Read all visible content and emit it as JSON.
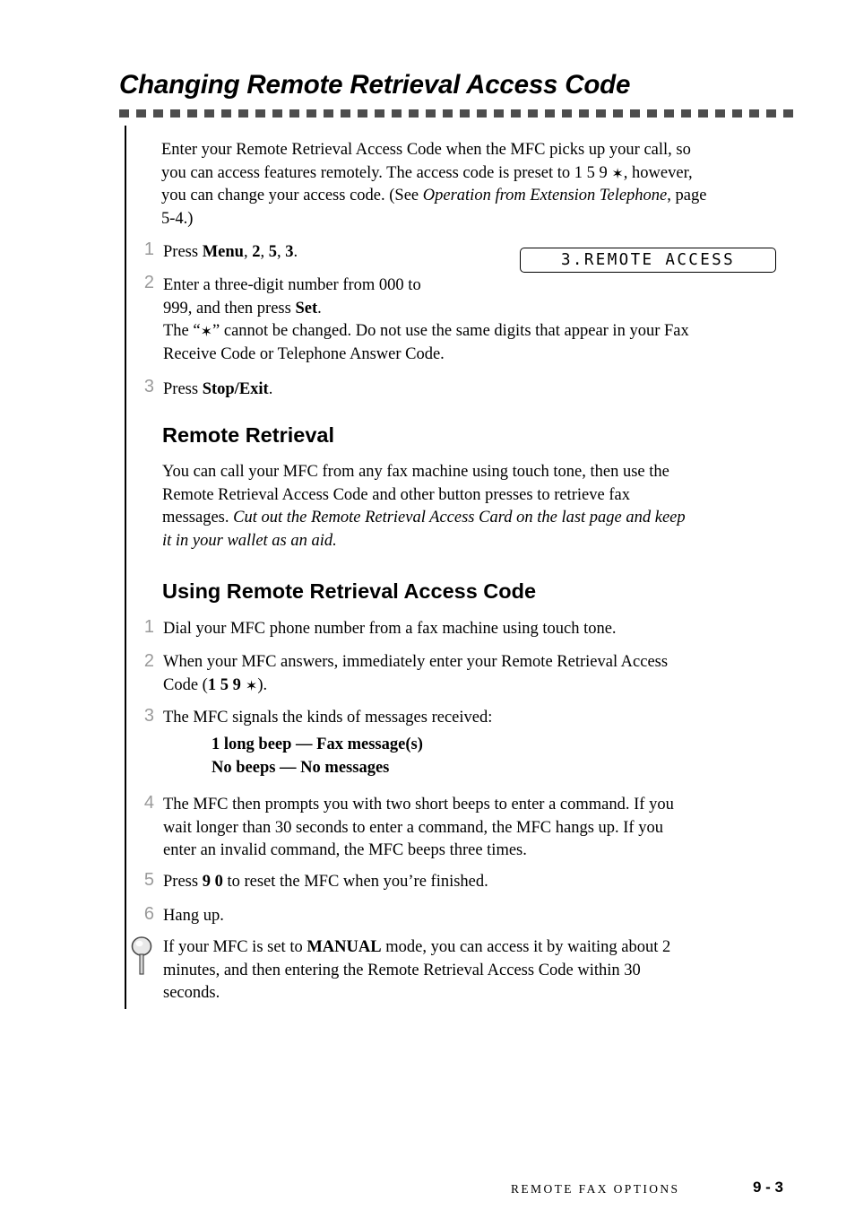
{
  "document": {
    "title": "Changing Remote Retrieval Access Code",
    "intro": "Enter your Remote Retrieval Access Code when the MFC picks up your call, so you can access features remotely.  The access code is preset to 1 5 9 ✶, however, you can change your access code. (See Operation from Extension Telephone, page 5-4.)",
    "intro_line1": "Enter your Remote Retrieval Access Code when the MFC picks up your call, so",
    "intro_line2a": "you can access features remotely.  The access code is preset to 1 5 9 ",
    "intro_line2b": ", however,",
    "intro_line3a": "you can change your access code. (See ",
    "intro_line3_italic": "Operation from Extension Telephone",
    "intro_line3b": ", page",
    "intro_line4": "5-4.)"
  },
  "steps_change": [
    {
      "num": "1",
      "line1_pre": "Press ",
      "line1_b1": "Menu",
      "line1_mid1": ", ",
      "line1_b2": "2",
      "line1_mid2": ", ",
      "line1_b3": "5",
      "line1_mid3": ", ",
      "line1_b4": "3",
      "line1_post": "."
    },
    {
      "num": "2",
      "line1": "Enter a three-digit number from 000 to",
      "line2_pre": "999, and then press ",
      "line2_b": "Set",
      "line2_post": ".",
      "line3_pre": "The “",
      "line3_post": "” cannot be changed. Do not use the same digits that appear in your Fax",
      "line4": "Receive Code or Telephone Answer Code."
    },
    {
      "num": "3",
      "line1_pre": "Press ",
      "line1_b": "Stop/Exit",
      "line1_post": "."
    }
  ],
  "lcd": {
    "text": "3.REMOTE ACCESS"
  },
  "section_remote_retrieval": {
    "heading": "Remote Retrieval",
    "line1": "You can call your MFC from any fax machine using touch tone, then use the",
    "line2": "Remote Retrieval Access Code and other button presses to retrieve fax",
    "line3_pre": "messages. ",
    "line3_italic": "Cut out the Remote Retrieval Access Card on the last page and keep",
    "line4_italic": "it in your wallet as an aid."
  },
  "section_using": {
    "heading": "Using Remote Retrieval Access Code",
    "steps": [
      {
        "num": "1",
        "line1": "Dial your MFC phone number from a fax machine using touch tone."
      },
      {
        "num": "2",
        "line1": "When your MFC answers, immediately enter your Remote Retrieval Access",
        "line2_pre": "Code (",
        "line2_b": "1 5 9",
        "line2_post": ")."
      },
      {
        "num": "3",
        "line1": "The MFC signals the kinds of messages received:",
        "bullet1": "1 long beep — Fax message(s)",
        "bullet2": "No beeps — No messages"
      },
      {
        "num": "4",
        "line1": "The MFC then prompts you with two short beeps to enter a command.  If you",
        "line2": "wait longer than 30 seconds to enter a command, the MFC hangs up.  If you",
        "line3": "enter an invalid command, the MFC beeps three times."
      },
      {
        "num": "5",
        "line1_pre": "Press ",
        "line1_b": "9 0",
        "line1_post": " to reset the MFC when you’re finished."
      },
      {
        "num": "6",
        "line1": "Hang up."
      }
    ]
  },
  "note": {
    "line1_pre": "If your MFC is set to ",
    "line1_caps": "MANUAL",
    "line1_post": " mode, you can access it by waiting about 2",
    "line2": "minutes, and then entering the Remote Retrieval Access Code within 30",
    "line3": "seconds."
  },
  "footer": {
    "section": "REMOTE FAX OPTIONS",
    "page": "9 - 3"
  },
  "colors": {
    "step_number": "#9a9a9a",
    "rule": "#4d4d4d",
    "text": "#000000"
  }
}
